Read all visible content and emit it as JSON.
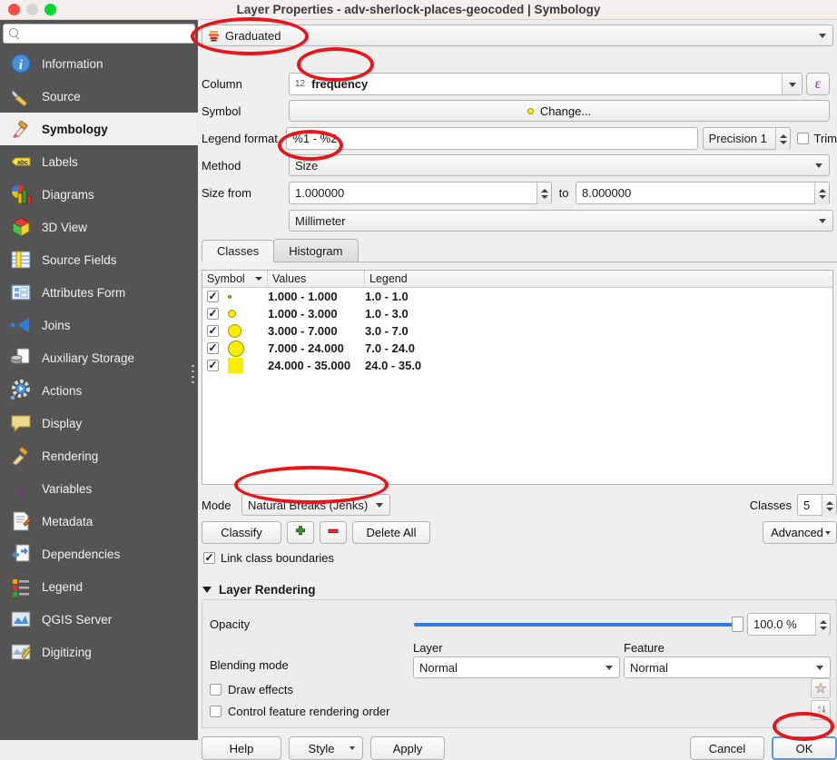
{
  "window": {
    "title": "Layer Properties - adv-sherlock-places-geocoded | Symbology",
    "controls": {
      "close": "close-button",
      "minimize": "minimize-button",
      "zoom": "zoom-button"
    }
  },
  "sidebar": {
    "search": {
      "value": "",
      "placeholder": ""
    },
    "items": [
      {
        "label": "Information",
        "icon": "information-icon",
        "active": false
      },
      {
        "label": "Source",
        "icon": "source-icon",
        "active": false
      },
      {
        "label": "Symbology",
        "icon": "symbology-icon",
        "active": true
      },
      {
        "label": "Labels",
        "icon": "labels-icon",
        "active": false
      },
      {
        "label": "Diagrams",
        "icon": "diagrams-icon",
        "active": false
      },
      {
        "label": "3D View",
        "icon": "3d-view-icon",
        "active": false
      },
      {
        "label": "Source Fields",
        "icon": "source-fields-icon",
        "active": false
      },
      {
        "label": "Attributes Form",
        "icon": "attributes-form-icon",
        "active": false
      },
      {
        "label": "Joins",
        "icon": "joins-icon",
        "active": false
      },
      {
        "label": "Auxiliary Storage",
        "icon": "auxiliary-storage-icon",
        "active": false
      },
      {
        "label": "Actions",
        "icon": "actions-icon",
        "active": false
      },
      {
        "label": "Display",
        "icon": "display-icon",
        "active": false
      },
      {
        "label": "Rendering",
        "icon": "rendering-icon",
        "active": false
      },
      {
        "label": "Variables",
        "icon": "variables-icon",
        "active": false
      },
      {
        "label": "Metadata",
        "icon": "metadata-icon",
        "active": false
      },
      {
        "label": "Dependencies",
        "icon": "dependencies-icon",
        "active": false
      },
      {
        "label": "Legend",
        "icon": "legend-icon",
        "active": false
      },
      {
        "label": "QGIS Server",
        "icon": "qgis-server-icon",
        "active": false
      },
      {
        "label": "Digitizing",
        "icon": "digitizing-icon",
        "active": false
      }
    ]
  },
  "symbology": {
    "renderer": {
      "value": "Graduated",
      "icon": "graduated-icon"
    },
    "column": {
      "label": "Column",
      "value": "frequency",
      "type_badge": "12",
      "expression_button": "ε"
    },
    "symbol": {
      "label": "Symbol",
      "button": "Change...",
      "swatch_color": "#ffed00"
    },
    "legend_format": {
      "label": "Legend format",
      "value": "%1 - %2"
    },
    "precision": {
      "value": "Precision 1"
    },
    "trim": {
      "label": "Trim",
      "checked": false
    },
    "method": {
      "label": "Method",
      "value": "Size"
    },
    "size_from": {
      "label": "Size from",
      "from": "1.000000",
      "to_label": "to",
      "to": "8.000000"
    },
    "size_unit": {
      "value": "Millimeter"
    },
    "tabs": [
      {
        "label": "Classes",
        "active": true
      },
      {
        "label": "Histogram",
        "active": false
      }
    ],
    "table": {
      "headers": [
        "Symbol",
        "Values",
        "Legend"
      ],
      "rows": [
        {
          "checked": true,
          "symbol_size": 3,
          "symbol_color": "#b8a900",
          "values": "1.000 - 1.000",
          "legend": "1.0 - 1.0"
        },
        {
          "checked": true,
          "symbol_size": 9,
          "symbol_color": "#ffed00",
          "values": "1.000 - 3.000",
          "legend": "1.0 - 3.0"
        },
        {
          "checked": true,
          "symbol_size": 15,
          "symbol_color": "#ffed00",
          "values": "3.000 - 7.000",
          "legend": "3.0 - 7.0"
        },
        {
          "checked": true,
          "symbol_size": 19,
          "symbol_color": "#ffed00",
          "values": "7.000 - 24.000",
          "legend": "7.0 - 24.0"
        },
        {
          "checked": true,
          "symbol_size": 22,
          "symbol_color": "#ffed00",
          "values": "24.000 - 35.000",
          "legend": "24.0 - 35.0"
        }
      ]
    },
    "mode": {
      "label": "Mode",
      "value": "Natural Breaks (Jenks)"
    },
    "classes": {
      "label": "Classes",
      "value": "5"
    },
    "buttons": {
      "classify": "Classify",
      "add": "add-class-button",
      "remove": "remove-class-button",
      "delete_all": "Delete All",
      "advanced": "Advanced"
    },
    "link_class_boundaries": {
      "label": "Link class boundaries",
      "checked": true
    }
  },
  "layer_rendering": {
    "title": "Layer Rendering",
    "opacity": {
      "label": "Opacity",
      "value": "100.0 %",
      "percent": 100
    },
    "blending": {
      "label": "Blending mode",
      "layer_label": "Layer",
      "layer_value": "Normal",
      "feature_label": "Feature",
      "feature_value": "Normal"
    },
    "draw_effects": {
      "label": "Draw effects",
      "checked": false
    },
    "control_order": {
      "label": "Control feature rendering order",
      "checked": false
    }
  },
  "footer": {
    "help": "Help",
    "style": "Style",
    "apply": "Apply",
    "cancel": "Cancel",
    "ok": "OK"
  },
  "annotations": {
    "highlight_color": "#e8151b",
    "highlighted": [
      "Graduated",
      "frequency",
      "Size",
      "Natural Breaks (Jenks)",
      "OK"
    ]
  }
}
